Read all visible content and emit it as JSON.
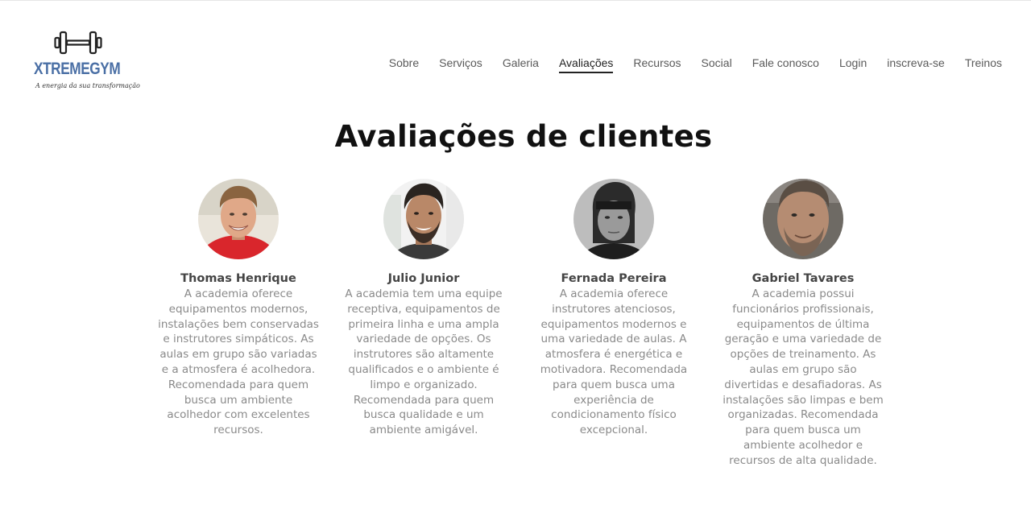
{
  "brand": {
    "name_part1": "XTREME",
    "name_part2": "GYM",
    "slogan": "A energia da sua transformação",
    "color": "#4a6fa5"
  },
  "nav": {
    "items": [
      {
        "label": "Sobre",
        "active": false
      },
      {
        "label": "Serviços",
        "active": false
      },
      {
        "label": "Galeria",
        "active": false
      },
      {
        "label": "Avaliações",
        "active": true
      },
      {
        "label": "Recursos",
        "active": false
      },
      {
        "label": "Social",
        "active": false
      },
      {
        "label": "Fale conosco",
        "active": false
      },
      {
        "label": "Login",
        "active": false
      },
      {
        "label": "inscreva-se",
        "active": false
      },
      {
        "label": "Treinos",
        "active": false
      }
    ]
  },
  "section": {
    "title": "Avaliações de clientes"
  },
  "reviews": [
    {
      "name": "Thomas Henrique",
      "avatar": "photo of smiling man in red shirt",
      "text": "A academia oferece equipamentos modernos, instalações bem conservadas e instrutores simpáticos. As aulas em grupo são variadas e a atmosfera é acolhedora. Recomendada para quem busca um ambiente acolhedor com excelentes recursos."
    },
    {
      "name": "Julio Junior",
      "avatar": "photo of bearded man smiling in gym",
      "text": "A academia tem uma equipe receptiva, equipamentos de primeira linha e uma ampla variedade de opções. Os instrutores são altamente qualificados e o ambiente é limpo e organizado. Recomendada para quem busca qualidade e um ambiente amigável."
    },
    {
      "name": "Fernada Pereira",
      "avatar": "black and white photo of woman with headband",
      "text": "A academia oferece instrutores atenciosos, equipamentos modernos e uma variedade de aulas. A atmosfera é energética e motivadora. Recomendada para quem busca uma experiência de condicionamento físico excepcional."
    },
    {
      "name": "Gabriel Tavares",
      "avatar": "photo of man with stubble close-up",
      "text": "A academia possui funcionários profissionais, equipamentos de última geração e uma variedade de opções de treinamento. As aulas em grupo são divertidas e desafiadoras. As instalações são limpas e bem organizadas. Recomendada para quem busca um ambiente acolhedor e recursos de alta qualidade."
    }
  ]
}
